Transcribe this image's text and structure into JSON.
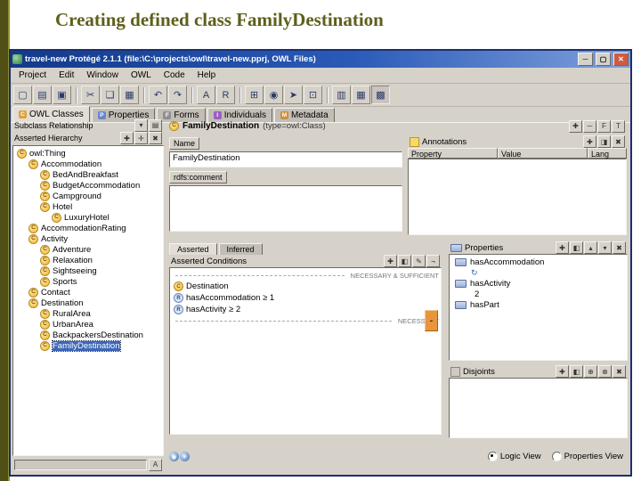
{
  "slide": {
    "title": "Creating defined class FamilyDestination"
  },
  "icons": {
    "class_glyph": "C"
  },
  "window": {
    "title": "travel-new   Protégé 2.1.1    (file:\\C:\\projects\\owl\\travel-new.pprj, OWL Files)",
    "controls": {
      "minimize": "─",
      "maximize": "▢",
      "close": "✕"
    }
  },
  "menubar": {
    "items": [
      {
        "label": "Project",
        "name": "menu-project"
      },
      {
        "label": "Edit",
        "name": "menu-edit"
      },
      {
        "label": "Window",
        "name": "menu-window"
      },
      {
        "label": "OWL",
        "name": "menu-owl"
      },
      {
        "label": "Code",
        "name": "menu-code"
      },
      {
        "label": "Help",
        "name": "menu-help"
      }
    ]
  },
  "toolbar": {
    "icons": [
      {
        "name": "new-project-icon",
        "glyph": "▢"
      },
      {
        "name": "open-project-icon",
        "glyph": "▤"
      },
      {
        "name": "save-project-icon",
        "glyph": "▣"
      },
      {
        "type": "sep"
      },
      {
        "name": "cut-icon",
        "glyph": "✂"
      },
      {
        "name": "copy-icon",
        "glyph": "❏"
      },
      {
        "name": "paste-icon",
        "glyph": "▦"
      },
      {
        "type": "sep"
      },
      {
        "name": "undo-icon",
        "glyph": "↶"
      },
      {
        "name": "redo-icon",
        "glyph": "↷"
      },
      {
        "type": "sep"
      },
      {
        "name": "letter-A-icon",
        "glyph": "A"
      },
      {
        "name": "letter-R-icon",
        "glyph": "R"
      },
      {
        "type": "sep"
      },
      {
        "name": "insert-widget-icon",
        "glyph": "⊞"
      },
      {
        "name": "ontology-globe-icon",
        "glyph": "◉"
      },
      {
        "name": "run-inference-icon",
        "glyph": "➤"
      },
      {
        "name": "expand-all-icon",
        "glyph": "⊡"
      },
      {
        "type": "sep"
      },
      {
        "name": "layout-icon",
        "glyph": "▥"
      },
      {
        "name": "table-icon",
        "glyph": "▦"
      },
      {
        "name": "grid-icon",
        "glyph": "▩",
        "pressed": true
      }
    ]
  },
  "tabs": {
    "items": [
      {
        "label": "OWL Classes",
        "icon": "C",
        "color": "#e0a23c",
        "selected": true,
        "name": "tab-owl-classes"
      },
      {
        "label": "Properties",
        "icon": "P",
        "color": "#6a84cf",
        "name": "tab-properties"
      },
      {
        "label": "Forms",
        "icon": "F",
        "color": "#8f8f8f",
        "name": "tab-forms"
      },
      {
        "label": "Individuals",
        "icon": "I",
        "color": "#9a5fc0",
        "name": "tab-individuals"
      },
      {
        "label": "Metadata",
        "icon": "M",
        "color": "#cf8f3a",
        "name": "tab-metadata"
      }
    ]
  },
  "hierarchy": {
    "title": "Subclass Relationship",
    "title_icons": [
      {
        "name": "panel-menu-icon",
        "glyph": "▾"
      },
      {
        "name": "panel-detach-icon",
        "glyph": "▤"
      }
    ],
    "subtitle": "Asserted Hierarchy",
    "sub_icons": [
      {
        "name": "create-class-icon",
        "glyph": "✚"
      },
      {
        "name": "create-subclass-icon",
        "glyph": "✛"
      },
      {
        "name": "delete-class-icon",
        "glyph": "✖"
      }
    ],
    "footer_icon": {
      "glyph": "A"
    },
    "tree": [
      {
        "label": "owl:Thing",
        "indent": 0
      },
      {
        "label": "Accommodation",
        "indent": 1
      },
      {
        "label": "BedAndBreakfast",
        "indent": 2
      },
      {
        "label": "BudgetAccommodation",
        "indent": 2
      },
      {
        "label": "Campground",
        "indent": 2
      },
      {
        "label": "Hotel",
        "indent": 2
      },
      {
        "label": "LuxuryHotel",
        "indent": 3
      },
      {
        "label": "AccommodationRating",
        "indent": 1
      },
      {
        "label": "Activity",
        "indent": 1
      },
      {
        "label": "Adventure",
        "indent": 2
      },
      {
        "label": "Relaxation",
        "indent": 2
      },
      {
        "label": "Sightseeing",
        "indent": 2
      },
      {
        "label": "Sports",
        "indent": 2
      },
      {
        "label": "Contact",
        "indent": 1
      },
      {
        "label": "Destination",
        "indent": 1
      },
      {
        "label": "RuralArea",
        "indent": 2
      },
      {
        "label": "UrbanArea",
        "indent": 2
      },
      {
        "label": "BackpackersDestination",
        "indent": 2
      },
      {
        "label": "FamilyDestination",
        "indent": 2,
        "selected": true,
        "name": "tree-item-family-destination"
      }
    ]
  },
  "editor": {
    "header": {
      "name": "FamilyDestination",
      "type_label": "(type=owl:Class)",
      "icons": [
        {
          "name": "add-class-icon",
          "glyph": "✚"
        },
        {
          "name": "remove-class-icon",
          "glyph": "─"
        },
        {
          "name": "letter-F-icon",
          "glyph": "F"
        },
        {
          "name": "letter-T-icon",
          "glyph": "T"
        }
      ]
    },
    "name_widget": {
      "label": "Name",
      "value": "FamilyDestination"
    },
    "comment_widget": {
      "label": "rdfs:comment",
      "value": ""
    },
    "annotations": {
      "title": "Annotations",
      "icons": [
        {
          "name": "create-annotation-icon",
          "glyph": "✚"
        },
        {
          "name": "add-annotation-icon",
          "glyph": "◨"
        },
        {
          "name": "delete-annotation-icon",
          "glyph": "✖"
        }
      ],
      "columns": [
        {
          "label": "Property"
        },
        {
          "label": "Value"
        },
        {
          "label": "Lang"
        }
      ]
    },
    "condition_tabs": [
      {
        "label": "Asserted",
        "selected": true,
        "name": "tab-asserted"
      },
      {
        "label": "Inferred",
        "name": "tab-inferred"
      }
    ],
    "conditions": {
      "title": "Asserted Conditions",
      "icons": [
        {
          "name": "create-condition-icon",
          "glyph": "✚"
        },
        {
          "name": "add-condition-icon",
          "glyph": "◧"
        },
        {
          "name": "edit-condition-icon",
          "glyph": "✎"
        },
        {
          "name": "negate-condition-icon",
          "glyph": "¬"
        }
      ],
      "remove_button": "-",
      "items": [
        {
          "type": "separator",
          "label": "NECESSARY & SUFFICIENT"
        },
        {
          "type": "class",
          "label": "Destination",
          "icon": "C"
        },
        {
          "type": "restriction",
          "label": "hasAccommodation ≥ 1",
          "icon": "R"
        },
        {
          "type": "restriction",
          "label": "hasActivity ≥ 2",
          "icon": "R"
        },
        {
          "type": "separator",
          "label": "NECESSARY"
        }
      ]
    },
    "properties": {
      "title": "Properties",
      "icons": [
        {
          "name": "create-property-icon",
          "glyph": "✚"
        },
        {
          "name": "add-property-icon",
          "glyph": "◧"
        },
        {
          "name": "move-up-icon",
          "glyph": "▴"
        },
        {
          "name": "move-down-icon",
          "glyph": "▾"
        },
        {
          "name": "delete-property-icon",
          "glyph": "✖"
        }
      ],
      "items": [
        {
          "type": "prop",
          "label": "hasAccommodation",
          "icon": ""
        },
        {
          "type": "sub",
          "label": "",
          "icon": "↻"
        },
        {
          "type": "prop",
          "label": "hasActivity",
          "icon": ""
        },
        {
          "type": "sub",
          "label": "2",
          "icon": ""
        },
        {
          "type": "prop",
          "label": "hasPart",
          "icon": ""
        }
      ]
    },
    "disjoints": {
      "title": "Disjoints",
      "icons": [
        {
          "name": "create-disjoint-icon",
          "glyph": "✚"
        },
        {
          "name": "add-disjoint-icon",
          "glyph": "◧"
        },
        {
          "name": "add-siblings-icon",
          "glyph": "⊕"
        },
        {
          "name": "mutual-disjoint-icon",
          "glyph": "⊗"
        },
        {
          "name": "delete-disjoint-icon",
          "glyph": "✖"
        }
      ]
    },
    "footer": {
      "icons": [
        {
          "name": "owl-logo-icon",
          "glyph": "◉"
        },
        {
          "name": "inference-icon",
          "glyph": "✳"
        }
      ],
      "views": [
        {
          "label": "Logic View",
          "selected": true,
          "name": "radio-logic-view"
        },
        {
          "label": "Properties View",
          "name": "radio-properties-view"
        }
      ]
    }
  }
}
